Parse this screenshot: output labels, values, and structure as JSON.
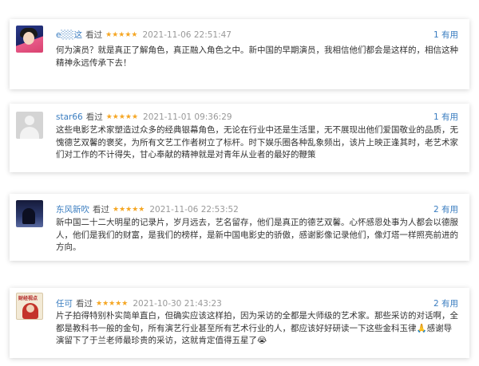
{
  "reviews": [
    {
      "username": "e░░这",
      "action": "看过",
      "stars": "★★★★★",
      "date": "2021-11-06 22:51:47",
      "useful": "1 有用",
      "text": "何为演员？就是真正了解角色，真正融入角色之中。新中国的早期演员，我相信他们都会是这样的，相信这种精神永远传承下去！",
      "avatar": "avatar-portrait"
    },
    {
      "username": "star66",
      "action": "看过",
      "stars": "★★★★★",
      "date": "2021-11-01 09:36:29",
      "useful": "1 有用",
      "text": "这些电影艺术家塑造过众多的经典银幕角色，无论在行业中还是生活里，无不展现出他们爱国敬业的品质，无愧德艺双馨的褒奖，为所有文艺工作者树立了标杆。时下娱乐圈各种乱象频出，该片上映正逢其时，老艺术家们对工作的不计得失，甘心奉献的精神就是对青年从业者的最好的鞭策",
      "avatar": "avatar-default"
    },
    {
      "username": "东风新吹",
      "action": "看过",
      "stars": "★★★★★",
      "date": "2021-11-06 22:53:52",
      "useful": "2 有用",
      "text": "新中国二十二大明星的记录片，岁月远去，艺名留存，他们是真正的德艺双馨。心怀感恩处事为人都会以德服人，他们是我们的财富，是我们的榜样，是新中国电影史的骄傲，感谢影像记录他们，像灯塔一样照亮前进的方向。",
      "avatar": "avatar-night"
    },
    {
      "username": "任可",
      "action": "看过",
      "stars": "★★★★★",
      "date": "2021-10-30 21:43:23",
      "useful": "2 有用",
      "text": "片子拍得特别朴实简单直白，但确实应该这样拍，因为采访的全都是大师级的艺术家。那些采访的对话啊，全都是教科书一般的金句，所有演艺行业甚至所有艺术行业的人，都应该好好研读一下这些金科玉律🙏感谢导演留下了于兰老师最珍贵的采访，这就肯定值得五星了😭",
      "avatar": "avatar-poster",
      "avatar_text": "财经视点"
    }
  ]
}
